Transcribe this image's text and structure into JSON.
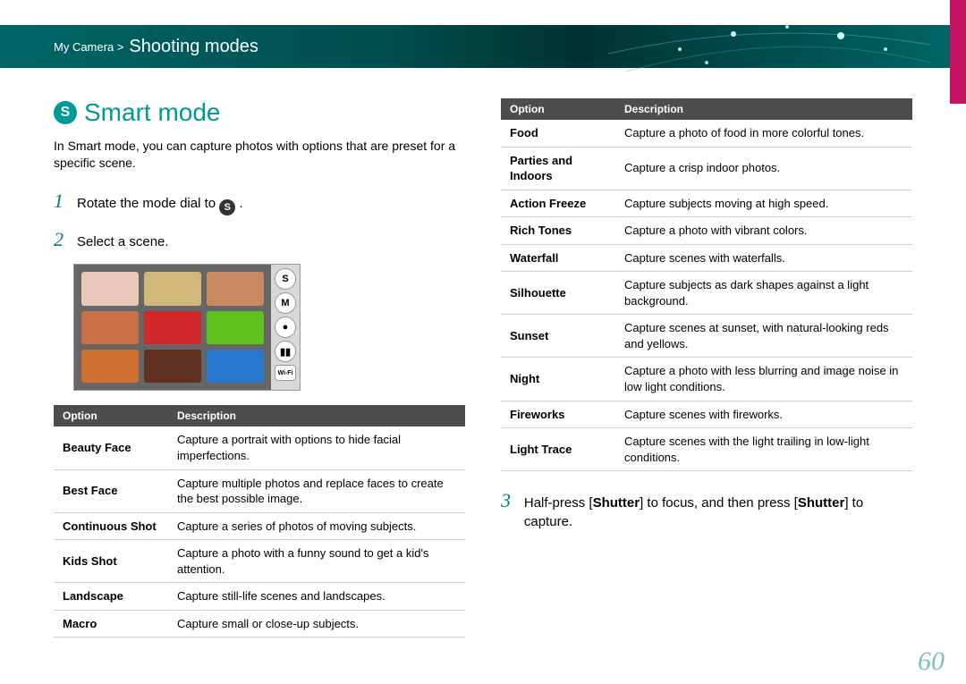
{
  "header": {
    "breadcrumb": "My Camera >",
    "title": "Shooting modes"
  },
  "heading": {
    "icon_letter": "S",
    "text": "Smart mode"
  },
  "intro": "In Smart mode, you can capture photos with options that are preset for a specific scene.",
  "steps": {
    "s1_num": "1",
    "s1_pre": "Rotate the mode dial to ",
    "s1_icon": "S",
    "s1_post": " .",
    "s2_num": "2",
    "s2_text": "Select a scene.",
    "s3_num": "3",
    "s3_pre": "Half-press [",
    "s3_b1": "Shutter",
    "s3_mid": "] to focus, and then press [",
    "s3_b2": "Shutter",
    "s3_post": "] to capture."
  },
  "mode_buttons": [
    "S",
    "M",
    "●",
    "▮▮",
    "Wi-Fi"
  ],
  "tables": {
    "header_option": "Option",
    "header_desc": "Description",
    "left": [
      {
        "o": "Beauty Face",
        "d": "Capture a portrait with options to hide facial imperfections."
      },
      {
        "o": "Best Face",
        "d": "Capture multiple photos and replace faces to create the best possible image."
      },
      {
        "o": "Continuous Shot",
        "d": "Capture a series of photos of moving subjects."
      },
      {
        "o": "Kids Shot",
        "d": "Capture a photo with a funny sound to get a kid's attention."
      },
      {
        "o": "Landscape",
        "d": "Capture still-life scenes and landscapes."
      },
      {
        "o": "Macro",
        "d": "Capture small or close-up subjects."
      }
    ],
    "right": [
      {
        "o": "Food",
        "d": "Capture a photo of food in more colorful tones."
      },
      {
        "o": "Parties and Indoors",
        "d": "Capture a crisp indoor photos."
      },
      {
        "o": "Action Freeze",
        "d": "Capture subjects moving at high speed."
      },
      {
        "o": "Rich Tones",
        "d": "Capture a photo with vibrant colors."
      },
      {
        "o": "Waterfall",
        "d": "Capture scenes with waterfalls."
      },
      {
        "o": "Silhouette",
        "d": "Capture subjects as dark shapes against a light background."
      },
      {
        "o": "Sunset",
        "d": "Capture scenes at sunset, with natural-looking reds and yellows."
      },
      {
        "o": "Night",
        "d": "Capture a photo with less blurring and image noise in low light conditions."
      },
      {
        "o": "Fireworks",
        "d": "Capture scenes with fireworks."
      },
      {
        "o": "Light Trace",
        "d": "Capture scenes with the light trailing in low-light conditions."
      }
    ]
  },
  "thumb_colors": [
    "#e8c8b8",
    "#d0b878",
    "#c88860",
    "#c87048",
    "#d02828",
    "#60c020",
    "#d07030",
    "#603020",
    "#2878d0"
  ],
  "page_number": "60"
}
